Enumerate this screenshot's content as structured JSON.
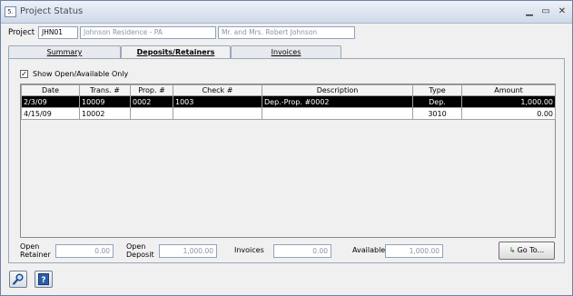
{
  "window": {
    "title": "Project Status",
    "minimize": "▁",
    "maximize": "▭",
    "close": "✕",
    "app_icon": "5."
  },
  "project": {
    "label": "Project",
    "code": "JHN01",
    "name": "Johnson Residence - PA",
    "client": "Mr. and Mrs. Robert Johnson"
  },
  "tabs": [
    {
      "label": "Summary",
      "active": false
    },
    {
      "label": "Deposits/Retainers",
      "active": true
    },
    {
      "label": "Invoices",
      "active": false
    }
  ],
  "filter": {
    "label": "Show Open/Available Only",
    "checked": true
  },
  "grid": {
    "columns": [
      "Date",
      "Trans. #",
      "Prop. #",
      "Check #",
      "Description",
      "Type",
      "Amount"
    ],
    "rows": [
      {
        "date": "2/3/09",
        "trans": "10009",
        "prop": "0002",
        "check": "1003",
        "description": "Dep.-Prop. #0002",
        "type": "Dep.",
        "amount": "1,000.00",
        "selected": true
      },
      {
        "date": "4/15/09",
        "trans": "10002",
        "prop": "",
        "check": "",
        "description": "",
        "type": "3010",
        "amount": "0.00",
        "selected": false
      }
    ]
  },
  "totals": {
    "open_retainer_label": [
      "Open",
      "Retainer"
    ],
    "open_retainer": "0.00",
    "open_deposit_label": [
      "Open",
      "Deposit"
    ],
    "open_deposit": "1,000.00",
    "invoices_label": "Invoices",
    "invoices": "0.00",
    "available_label": "Available",
    "available": "1,000.00"
  },
  "buttons": {
    "goto": "Go To...",
    "search": "search-icon",
    "help": "help-icon"
  }
}
